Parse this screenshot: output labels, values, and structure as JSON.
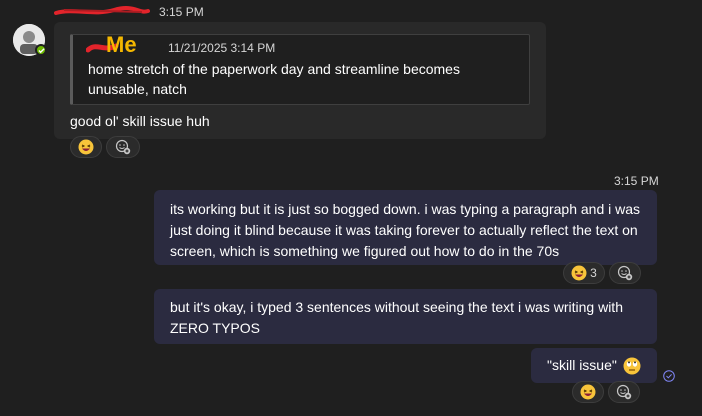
{
  "incoming": {
    "sender": "",
    "timestamp": "3:15 PM",
    "quote": {
      "author": "Me",
      "timestamp": "11/21/2025 3:14 PM",
      "text": "home stretch of the paperwork day and streamline becomes unusable, natch"
    },
    "text": "good ol' skill issue huh",
    "reactions": [
      {
        "emoji": "laughing-face",
        "count": ""
      }
    ]
  },
  "outgoing": {
    "timestamp": "3:15 PM",
    "messages": [
      {
        "text": "its working but it is just so bogged down. i was typing a paragraph and i was just doing it blind because it was taking forever to actually reflect the text on screen, which is something we figured out how to do in the 70s",
        "reactions": [
          {
            "emoji": "laughing-face",
            "count": "3"
          }
        ]
      },
      {
        "text": "but it's okay, i typed 3 sentences without seeing the text i was writing with ZERO TYPOS"
      },
      {
        "text": "\"skill issue\"",
        "emoji": "eye-roll-face",
        "reactions": [
          {
            "emoji": "laughing-face",
            "count": ""
          }
        ]
      }
    ],
    "status": "sent"
  },
  "colors": {
    "background": "#1f1f1f",
    "incoming_bubble": "#292929",
    "outgoing_bubble": "#2b2b40",
    "accent": "#7f85f5",
    "redaction": "#e3242b",
    "me_label": "#f5b800"
  }
}
